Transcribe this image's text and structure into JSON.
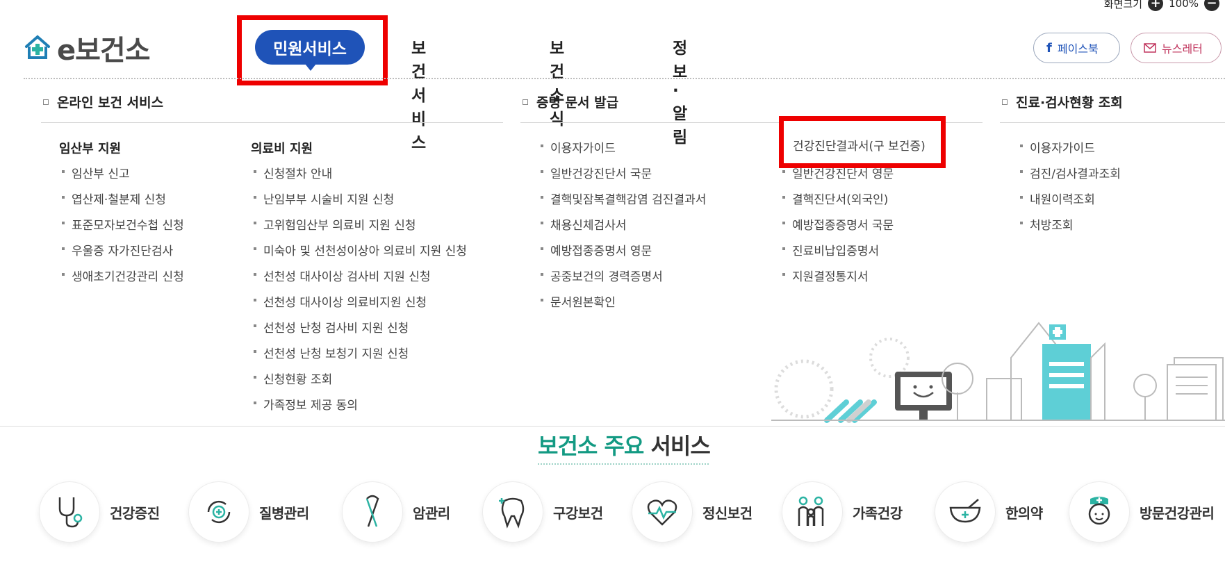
{
  "zoom": {
    "label": "화면크기",
    "value": "100%"
  },
  "header": {
    "logo_text": "e보건소",
    "nav": [
      {
        "label": "민원서비스",
        "active": true
      },
      {
        "label": "보건서비스"
      },
      {
        "label": "보건소식"
      },
      {
        "label": "정보·알림"
      }
    ],
    "sns": {
      "facebook": "페이스북",
      "newsletter": "뉴스레터"
    }
  },
  "megamenu": {
    "col1": {
      "title": "온라인 보건 서비스",
      "groups": [
        {
          "title": "임산부 지원",
          "items": [
            "임산부 신고",
            "엽산제·철분제 신청",
            "표준모자보건수첩 신청",
            "우울증 자가진단검사",
            "생애초기건강관리 신청"
          ]
        },
        {
          "title": "의료비 지원",
          "items": [
            "신청절차 안내",
            "난임부부 시술비 지원 신청",
            "고위험임산부 의료비 지원 신청",
            "미숙아 및 선천성이상아 의료비 지원 신청",
            "선천성 대사이상 검사비 지원 신청",
            "선천성 대사이상 의료비지원 신청",
            "선천성 난청 검사비 지원 신청",
            "선천성 난청 보청기 지원 신청",
            "신청현황 조회",
            "가족정보 제공 동의"
          ]
        }
      ]
    },
    "col2": {
      "title": "증명 문서 발급",
      "left": [
        "이용자가이드",
        "일반건강진단서 국문",
        "결핵및잠복결핵감염 검진결과서",
        "채용신체검사서",
        "예방접종증명서 영문",
        "공중보건의 경력증명서",
        "문서원본확인"
      ],
      "right": [
        "건강진단결과서(구 보건증)",
        "일반건강진단서 영문",
        "결핵진단서(외국인)",
        "예방접종증명서 국문",
        "진료비납입증명서",
        "지원결정통지서"
      ]
    },
    "col3": {
      "title": "진료·검사현황 조회",
      "items": [
        "이용자가이드",
        "검진/검사결과조회",
        "내원이력조회",
        "처방조회"
      ]
    }
  },
  "services": {
    "title_highlight": "보건소 주요",
    "title_rest": " 서비스",
    "items": [
      {
        "label": "건강증진",
        "icon": "stethoscope-icon"
      },
      {
        "label": "질병관리",
        "icon": "disease-cycle-icon"
      },
      {
        "label": "암관리",
        "icon": "cancer-ribbon-icon"
      },
      {
        "label": "구강보건",
        "icon": "tooth-icon"
      },
      {
        "label": "정신보건",
        "icon": "heart-pulse-icon"
      },
      {
        "label": "가족건강",
        "icon": "family-icon"
      },
      {
        "label": "한의약",
        "icon": "herbal-bowl-icon"
      },
      {
        "label": "방문건강관리",
        "icon": "nurse-icon"
      }
    ]
  },
  "colors": {
    "primary": "#1f53b8",
    "accent_green": "#139a83",
    "highlight_red": "#ee0000"
  }
}
